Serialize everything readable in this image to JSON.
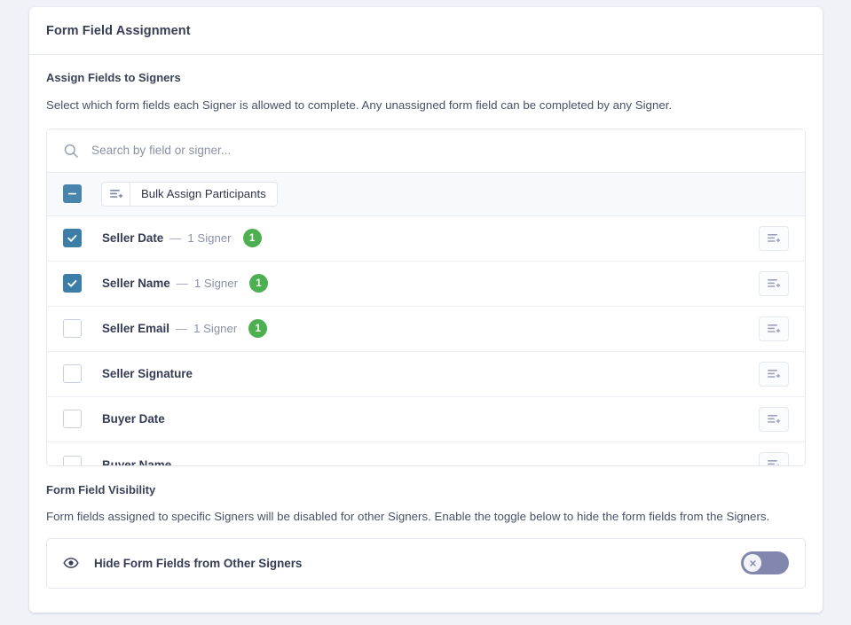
{
  "card": {
    "title": "Form Field Assignment"
  },
  "assign_section": {
    "title": "Assign Fields to Signers",
    "description": "Select which form fields each Signer is allowed to complete. Any unassigned form field can be completed by any Signer."
  },
  "search": {
    "placeholder": "Search by field or signer...",
    "value": "",
    "icon": "search-icon"
  },
  "bulk": {
    "checkbox_state": "indeterminate",
    "button_label": "Bulk Assign Participants",
    "button_icon": "assign-participants-icon"
  },
  "fields": [
    {
      "name": "Seller Date",
      "dash": "—",
      "signers_text": "1 Signer",
      "badge": "1",
      "checked": true,
      "action_icon": "assign-participants-icon"
    },
    {
      "name": "Seller Name",
      "dash": "—",
      "signers_text": "1 Signer",
      "badge": "1",
      "checked": true,
      "action_icon": "assign-participants-icon"
    },
    {
      "name": "Seller Email",
      "dash": "—",
      "signers_text": "1 Signer",
      "badge": "1",
      "checked": false,
      "action_icon": "assign-participants-icon"
    },
    {
      "name": "Seller Signature",
      "dash": "",
      "signers_text": "",
      "badge": "",
      "checked": false,
      "action_icon": "assign-participants-icon"
    },
    {
      "name": "Buyer Date",
      "dash": "",
      "signers_text": "",
      "badge": "",
      "checked": false,
      "action_icon": "assign-participants-icon"
    },
    {
      "name": "Buyer Name",
      "dash": "",
      "signers_text": "",
      "badge": "",
      "checked": false,
      "action_icon": "assign-participants-icon"
    }
  ],
  "visibility_section": {
    "title": "Form Field Visibility",
    "description": "Form fields assigned to specific Signers will be disabled for other Signers. Enable the toggle below to hide the form fields from the Signers.",
    "toggle_label": "Hide Form Fields from Other Signers",
    "toggle_icon": "eye-icon",
    "toggle_on": false,
    "toggle_knob_glyph": "✕"
  },
  "colors": {
    "page_background": "#eff3f8",
    "checkbox_checked": "#3d7ea8",
    "badge_green": "#4caf50",
    "toggle_off": "#8287ad",
    "text_primary": "#343b52",
    "text_muted": "#8b91a6"
  }
}
